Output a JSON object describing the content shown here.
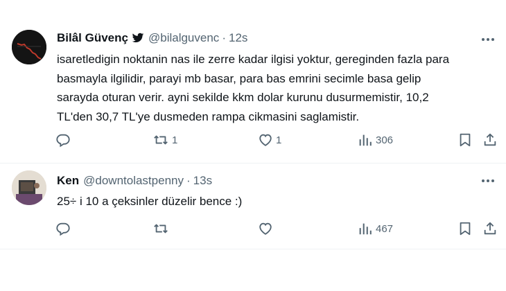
{
  "tweets": [
    {
      "display_name": "Bilâl Güvenç",
      "handle": "@bilalguvenc",
      "separator": "·",
      "time": "12s",
      "verified": true,
      "body_lines": [
        "isaretledigin noktanin nas ile zerre kadar ilgisi yoktur, gereginden fazla para",
        "basmayla ilgilidir, parayi mb basar, para bas emrini secimle basa gelip",
        "sarayda oturan verir. ayni sekilde kkm dolar kurunu dusurmemistir, 10,2",
        "TL'den 30,7 TL'ye dusmeden rampa cikmasini saglamistir."
      ],
      "replies": "",
      "retweets": "1",
      "likes": "1",
      "views": "306"
    },
    {
      "display_name": "Ken",
      "handle": "@downtolastpenny",
      "separator": "·",
      "time": "13s",
      "verified": false,
      "body_lines": [
        "25÷ i 10 a çeksinler düzelir bence :)"
      ],
      "replies": "",
      "retweets": "",
      "likes": "",
      "views": "467"
    }
  ],
  "icons": {
    "verified": "bird-badge-icon",
    "more": "more-dots-icon",
    "reply": "reply-icon",
    "retweet": "retweet-icon",
    "like": "heart-icon",
    "views": "views-chart-icon",
    "bookmark": "bookmark-icon",
    "share": "share-icon"
  },
  "colors": {
    "text": "#0f1419",
    "secondary": "#536471",
    "divider": "#eff3f4"
  }
}
